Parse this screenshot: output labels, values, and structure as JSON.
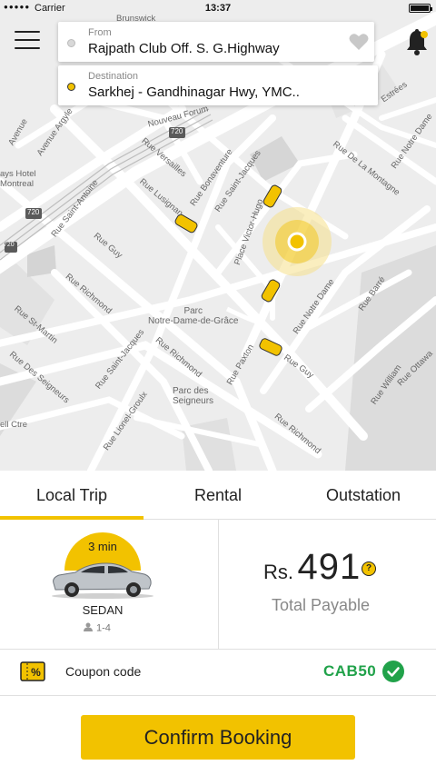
{
  "status_bar": {
    "carrier": "Carrier",
    "time": "13:37"
  },
  "header": {
    "menu_icon": "hamburger-menu-icon",
    "notification_icon": "bell-icon"
  },
  "from": {
    "label": "From",
    "value": "Rajpath Club Off. S. G.Highway",
    "icon": "heart-icon"
  },
  "destination": {
    "label": "Destination",
    "value": "Sarkhej - Gandhinagar Hwy, YMC.."
  },
  "map": {
    "labels": {
      "avenue_argyle": "Avenue Argyle",
      "nouveau_forum": "Nouveau Forum",
      "rue_versailles": "Rue Versailles",
      "rue_lusignan": "Rue Lusignan",
      "rue_bonaventure": "Rue Bonaventure",
      "rue_saint_jacques_top": "Rue Saint-Jacques",
      "place_victor_hugo": "Place Victor-Hugo",
      "rue_saint_antoine": "Rue Saint-Antoine",
      "rue_guy_left": "Rue Guy",
      "rue_richmond_left": "Rue Richmond",
      "parc_ndg": "Parc\nNotre-Dame-de-Grâce",
      "rue_st_martin": "Rue St-Martin",
      "rue_saint_jacques_mid": "Rue Saint-Jacques",
      "rue_richmond_mid": "Rue Richmond",
      "rue_des_seigneurs": "Rue Des Seigneurs",
      "rue_lionel_groulx": "Rue Lionel-Groulx",
      "parc_des_seigneurs": "Parc des\nSeigneurs",
      "rue_richmond_bottom": "Rue Richmond",
      "rue_paxton": "Rue Paxton",
      "rue_guy_right": "Rue Guy",
      "rue_notre_dame": "Rue Notre Dame",
      "rue_de_la_montagne": "Rue De La Montagne",
      "rue_notre_dame_right": "Rue Notre Dame",
      "rue_barre": "Rue Barré",
      "rue_william": "Rue William",
      "rue_ottawa": "Rue Ottawa",
      "estrees": "Estrées",
      "hotel": "ays Hotel\nMontreal",
      "ell_ctre": "ell Ctre",
      "avenue_left": "Avenue",
      "brunswick": "Brunswick",
      "route_720a": "720",
      "route_720b": "720",
      "route_720c": "720"
    }
  },
  "tabs": [
    {
      "label": "Local Trip",
      "active": true
    },
    {
      "label": "Rental",
      "active": false
    },
    {
      "label": "Outstation",
      "active": false
    }
  ],
  "ride": {
    "eta": "3 min",
    "car_type": "SEDAN",
    "seats": "1-4",
    "currency": "Rs.",
    "fare": "491",
    "help_symbol": "?",
    "total_label": "Total Payable"
  },
  "coupon": {
    "label": "Coupon code",
    "code": "CAB50",
    "icon": "coupon-ticket-icon",
    "status_icon": "check-icon"
  },
  "confirm_label": "Confirm Booking",
  "colors": {
    "accent": "#f2c200",
    "success": "#21a24a",
    "map_bg": "#ededed"
  }
}
